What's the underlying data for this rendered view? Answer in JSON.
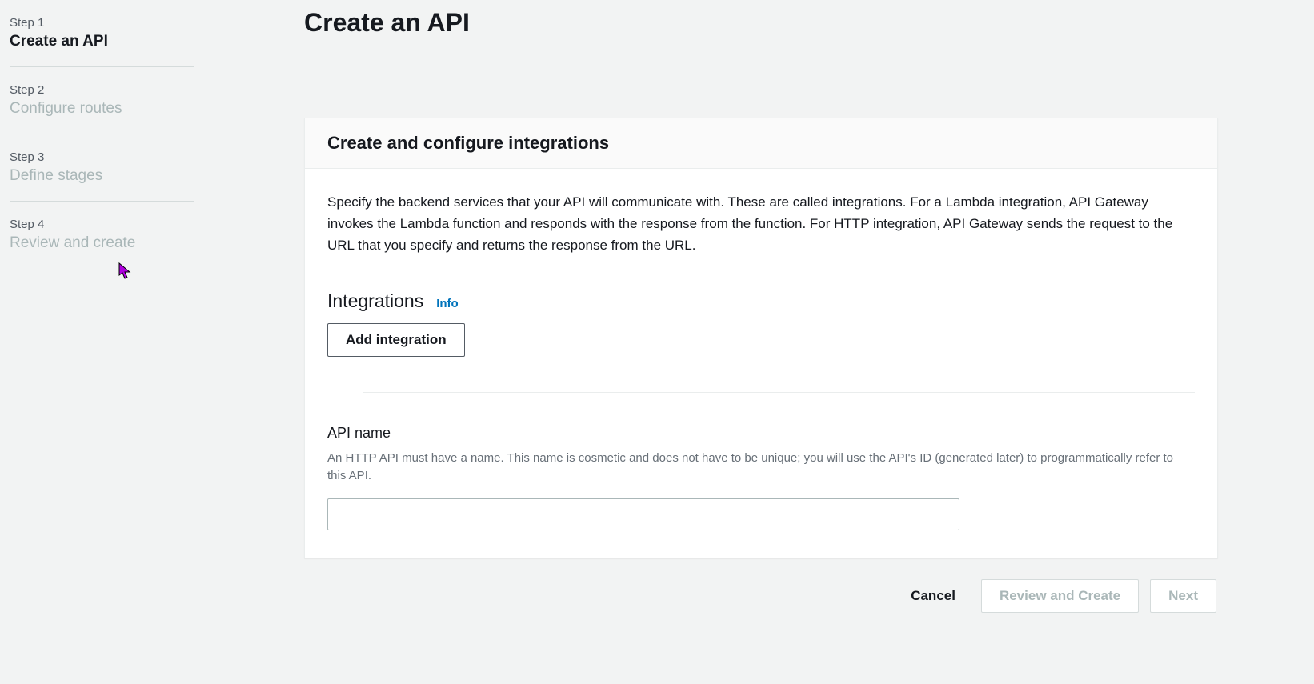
{
  "sidebar": {
    "steps": [
      {
        "num": "Step 1",
        "title": "Create an API"
      },
      {
        "num": "Step 2",
        "title": "Configure routes"
      },
      {
        "num": "Step 3",
        "title": "Define stages"
      },
      {
        "num": "Step 4",
        "title": "Review and create"
      }
    ]
  },
  "main": {
    "page_title": "Create an API",
    "panel_heading": "Create and configure integrations",
    "description": "Specify the backend services that your API will communicate with. These are called integrations. For a Lambda integration, API Gateway invokes the Lambda function and responds with the response from the function. For HTTP integration, API Gateway sends the request to the URL that you specify and returns the response from the URL.",
    "integrations_heading": "Integrations",
    "info_label": "Info",
    "add_integration_label": "Add integration",
    "api_name_label": "API name",
    "api_name_help": "An HTTP API must have a name. This name is cosmetic and does not have to be unique; you will use the API's ID (generated later) to programmatically refer to this API.",
    "api_name_value": ""
  },
  "footer": {
    "cancel": "Cancel",
    "review": "Review and Create",
    "next": "Next"
  }
}
